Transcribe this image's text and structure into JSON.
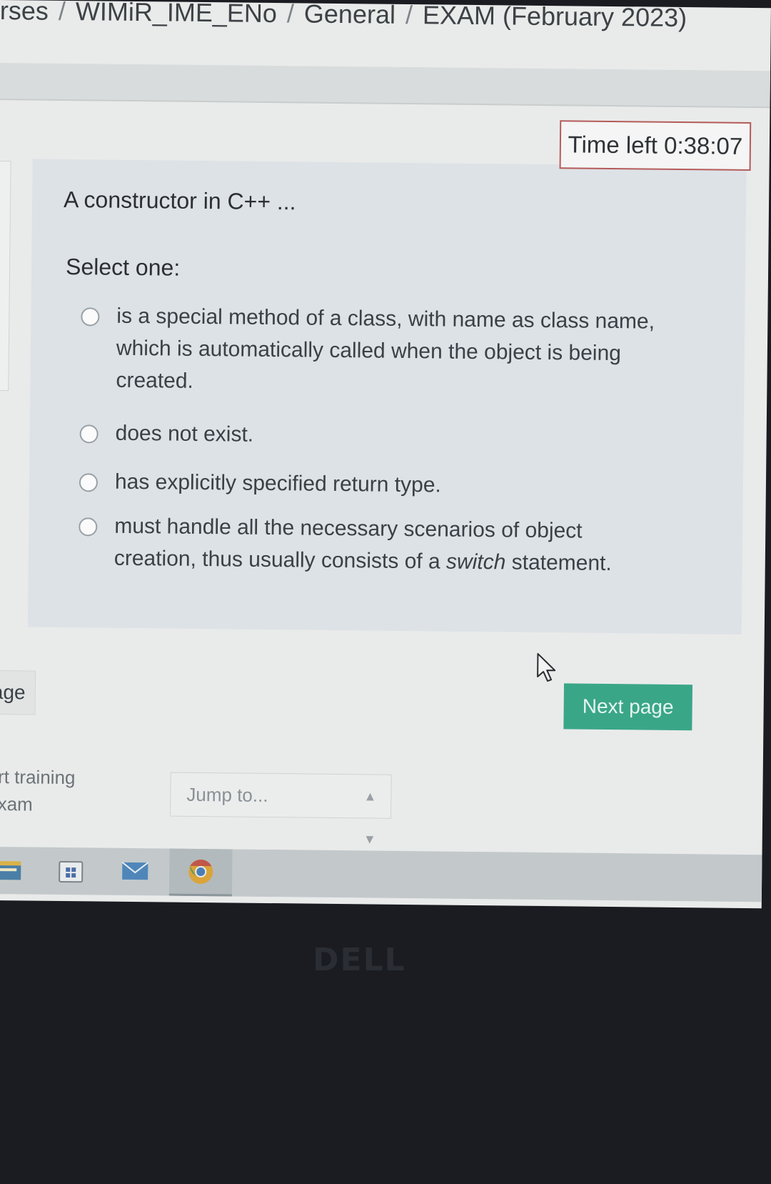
{
  "breadcrumb": {
    "items": [
      "rses",
      "WIMiR_IME_ENo",
      "General",
      "EXAM (February 2023)"
    ],
    "separator": "/"
  },
  "timer": {
    "label": "Time left 0:38:07"
  },
  "question": {
    "text": "A constructor in C++ ...",
    "prompt": "Select one:",
    "options": [
      {
        "label": "is a special method of a class, with name as class name, which is automatically called when the object is being created."
      },
      {
        "label": "does not exist."
      },
      {
        "label": "has explicitly specified return type."
      },
      {
        "label_before": "must handle all the necessary scenarios of object creation, thus usually consists of a ",
        "label_emphasis": "switch",
        "label_after": " statement."
      }
    ]
  },
  "navigation": {
    "previous_label": "age",
    "next_label": "Next page"
  },
  "sidebar_links": {
    "line1": "ort training",
    "line2": "exam"
  },
  "jump": {
    "placeholder": "Jump to..."
  },
  "taskbar": {
    "icons": [
      "file-explorer-icon",
      "store-icon",
      "mail-icon",
      "chrome-icon"
    ]
  },
  "bezel": {
    "logo": "DELL"
  },
  "colors": {
    "accent": "#3aa688",
    "timer_border": "#b55a5a",
    "panel": "#dde2e6"
  }
}
